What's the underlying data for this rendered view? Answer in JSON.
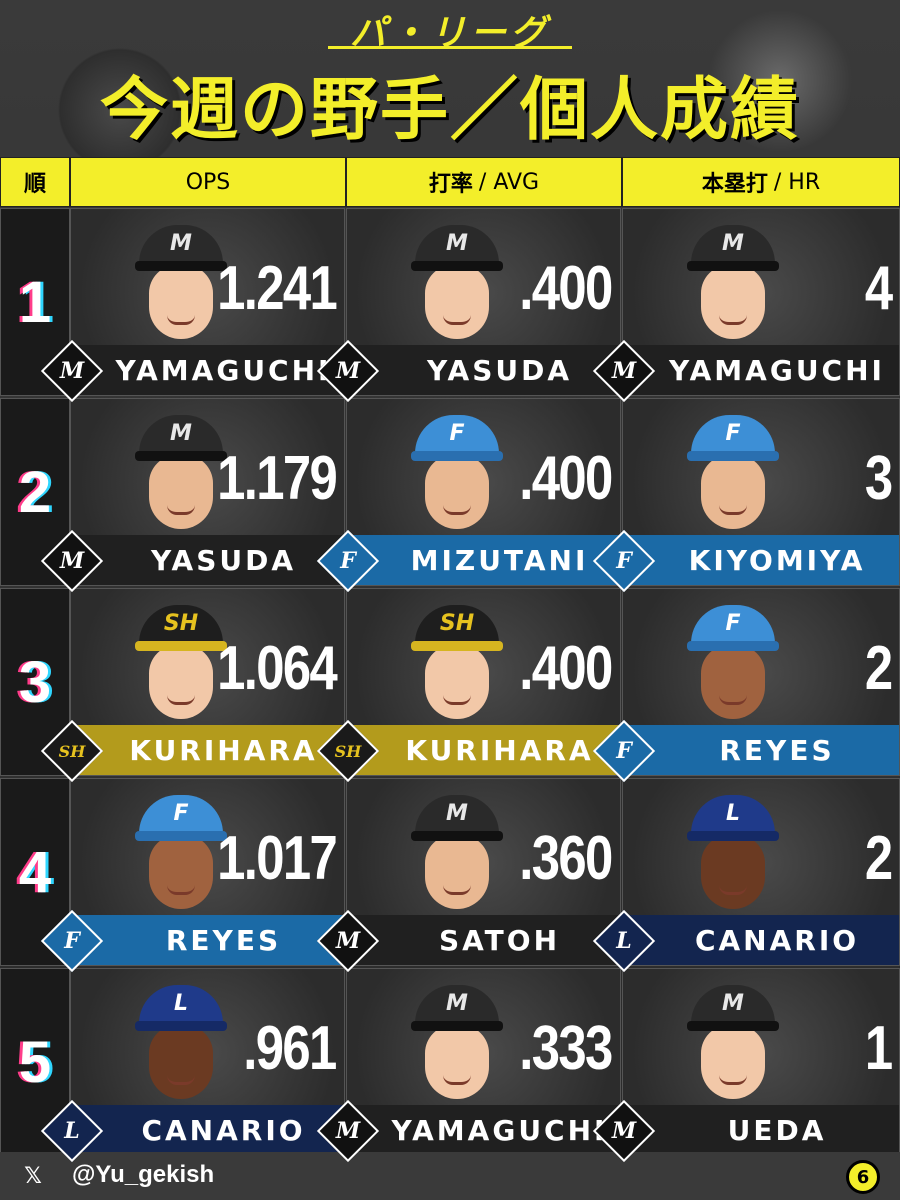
{
  "header": {
    "league": "パ・リーグ",
    "title": "今週の野手／個人成績"
  },
  "columns": {
    "rank": "順",
    "ops": "OPS",
    "avg_jp": "打率",
    "avg_en": "/ AVG",
    "hr_jp": "本塁打",
    "hr_en": "/ HR"
  },
  "team_colors": {
    "M": "#202020",
    "F": "#1b6aa6",
    "H": "#b39b1c",
    "L": "#13254f"
  },
  "team_icons": {
    "M": "marines-logo-icon",
    "F": "fighters-logo-icon",
    "H": "hawks-logo-icon",
    "L": "lions-logo-icon"
  },
  "rows": [
    {
      "rank": "1",
      "ops": {
        "value": "1.241",
        "name": "YAMAGUCHI",
        "team": "M"
      },
      "avg": {
        "value": ".400",
        "name": "YASUDA",
        "team": "M"
      },
      "hr": {
        "value": "4",
        "name": "YAMAGUCHI",
        "team": "M"
      }
    },
    {
      "rank": "2",
      "ops": {
        "value": "1.179",
        "name": "YASUDA",
        "team": "M"
      },
      "avg": {
        "value": ".400",
        "name": "MIZUTANI",
        "team": "F"
      },
      "hr": {
        "value": "3",
        "name": "KIYOMIYA",
        "team": "F"
      }
    },
    {
      "rank": "3",
      "ops": {
        "value": "1.064",
        "name": "KURIHARA",
        "team": "H"
      },
      "avg": {
        "value": ".400",
        "name": "KURIHARA",
        "team": "H"
      },
      "hr": {
        "value": "2",
        "name": "REYES",
        "team": "F"
      }
    },
    {
      "rank": "4",
      "ops": {
        "value": "1.017",
        "name": "REYES",
        "team": "F"
      },
      "avg": {
        "value": ".360",
        "name": "SATOH",
        "team": "M"
      },
      "hr": {
        "value": "2",
        "name": "CANARIO",
        "team": "L"
      }
    },
    {
      "rank": "5",
      "ops": {
        "value": ".961",
        "name": "CANARIO",
        "team": "L"
      },
      "avg": {
        "value": ".333",
        "name": "YAMAGUCHI",
        "team": "M"
      },
      "hr": {
        "value": "1",
        "name": "UEDA",
        "team": "M"
      }
    }
  ],
  "footer": {
    "x_icon": "x-logo-icon",
    "handle": "@Yu_gekish",
    "badge": "6"
  }
}
